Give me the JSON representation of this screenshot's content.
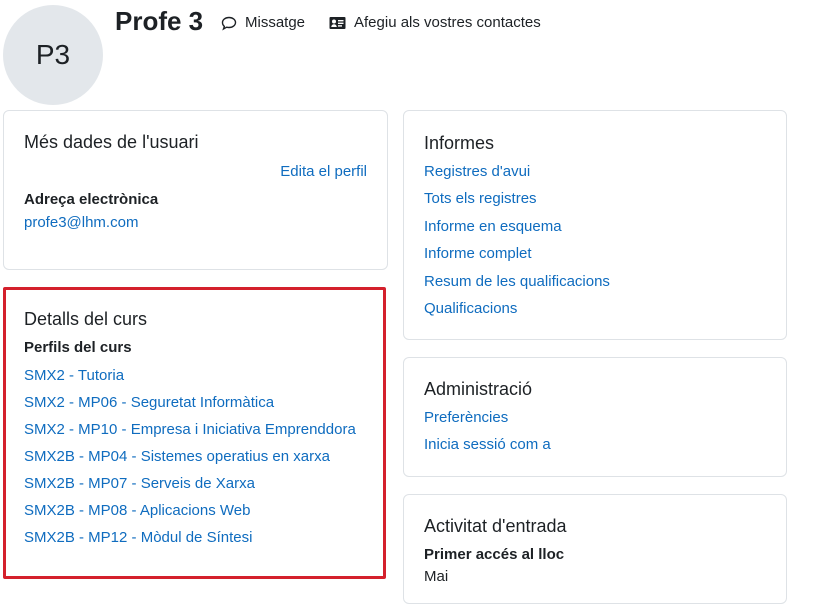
{
  "profile": {
    "initials": "P3",
    "name": "Profe 3",
    "message_label": "Missatge",
    "add_contact_label": "Afegiu als vostres contactes",
    "message_icon": "speech-bubble-icon",
    "contact_icon": "address-card-icon"
  },
  "user_details": {
    "title": "Més dades de l'usuari",
    "edit_label": "Edita el perfil",
    "email_heading": "Adreça electrònica",
    "email": "profe3@lhm.com"
  },
  "course_details": {
    "title": "Detalls del curs",
    "profiles_heading": "Perfils del curs",
    "courses": [
      "SMX2 - Tutoria",
      "SMX2 - MP06 - Seguretat Informàtica",
      "SMX2 - MP10 - Empresa i Iniciativa Emprenddora",
      "SMX2B - MP04 - Sistemes operatius en xarxa",
      "SMX2B - MP07 - Serveis de Xarxa",
      "SMX2B - MP08 - Aplicacions Web",
      "SMX2B - MP12 - Mòdul de Síntesi"
    ]
  },
  "reports": {
    "title": "Informes",
    "links": [
      "Registres d'avui",
      "Tots els registres",
      "Informe en esquema",
      "Informe complet",
      "Resum de les qualificacions",
      "Qualificacions"
    ]
  },
  "administration": {
    "title": "Administració",
    "links": [
      "Preferències",
      "Inicia sessió com a"
    ]
  },
  "login_activity": {
    "title": "Activitat d'entrada",
    "first_access_heading": "Primer accés al lloc",
    "first_access_value": "Mai"
  },
  "colors": {
    "link": "#0f6cbf",
    "highlight_border": "#d4202c",
    "avatar_bg": "#e3e7eb"
  }
}
